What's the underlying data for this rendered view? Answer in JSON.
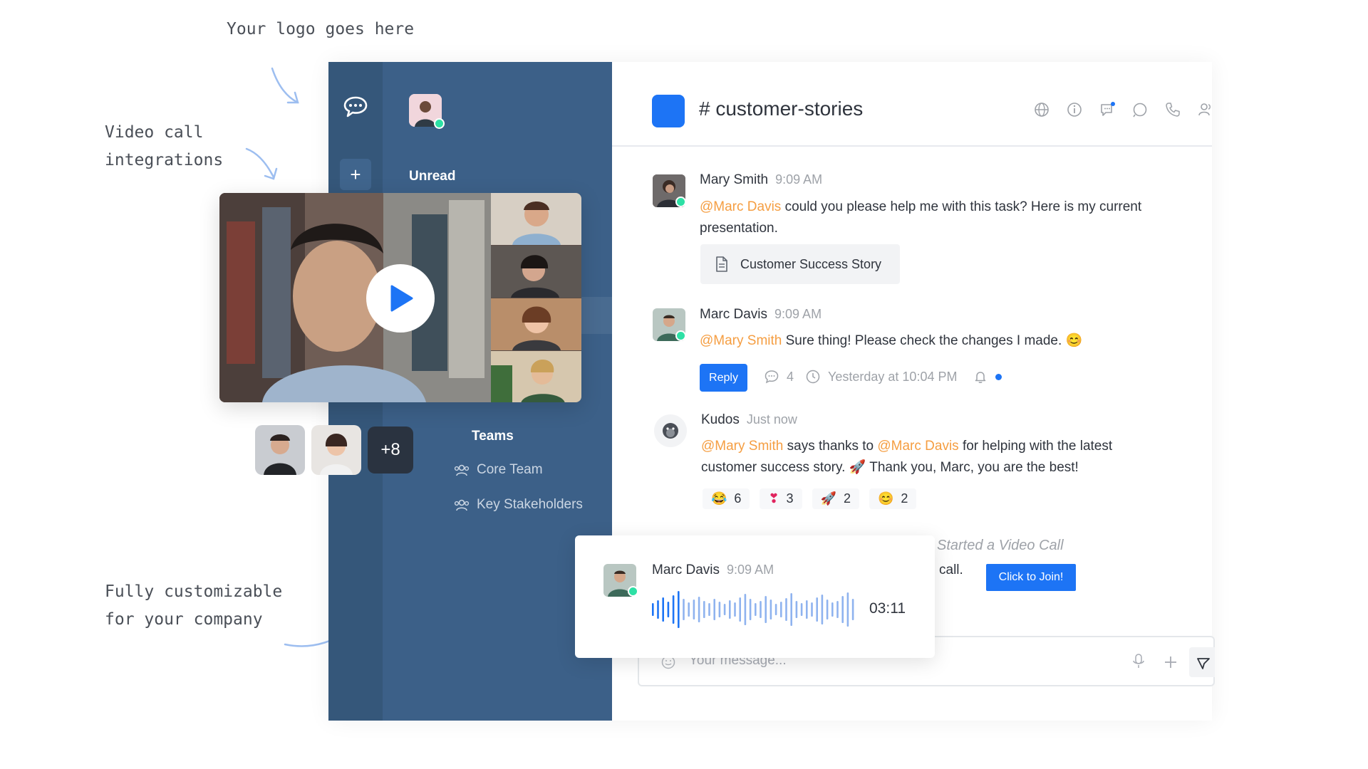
{
  "annotations": {
    "logo": "Your logo goes here",
    "video_line1": "Video call",
    "video_line2": "integrations",
    "custom_line1": "Fully customizable",
    "custom_line2": "for your company"
  },
  "rail": {
    "logo_icon": "chat-bubble-icon",
    "plus": "+"
  },
  "sidebar": {
    "section_unread": "Unread",
    "section_teams": "Teams",
    "teams": [
      {
        "label": "Core Team",
        "icon": "team-icon"
      },
      {
        "label": "Key Stakeholders",
        "icon": "team-icon"
      }
    ]
  },
  "header": {
    "channel": "# customer-stories",
    "icons": [
      "globe-icon",
      "info-icon",
      "threads-icon",
      "discussion-icon",
      "phone-icon",
      "members-icon"
    ]
  },
  "messages": [
    {
      "author": "Mary Smith",
      "time": "9:09 AM",
      "mention": "@Marc Davis",
      "text": " could you please help me with this task? Here is my current presentation.",
      "attachment": "Customer Success Story"
    },
    {
      "author": "Marc Davis",
      "time": "9:09 AM",
      "mention": "@Mary Smith",
      "text": " Sure thing! Please check the changes I made. 😊",
      "reply_label": "Reply",
      "reply_count": "4",
      "last_reply": "Yesterday at 10:04 PM"
    },
    {
      "author": "Kudos",
      "time": "Just now",
      "mention1": "@Mary Smith",
      "text1": " says thanks to ",
      "mention2": "@Marc Davis",
      "text2": " for helping with the latest customer success story. 🚀 Thank you, Marc, you are the best!",
      "reactions": [
        {
          "emoji": "😂",
          "count": "6"
        },
        {
          "emoji": "❣",
          "count": "3"
        },
        {
          "emoji": "🚀",
          "count": "2"
        },
        {
          "emoji": "😊",
          "count": "2"
        }
      ]
    }
  ],
  "video_call": {
    "system": "Started a Video Call",
    "call_text": "call.",
    "join_label": "Click to Join!",
    "more_participants": "+8"
  },
  "audio_message": {
    "author": "Marc Davis",
    "time": "9:09 AM",
    "duration": "03:11"
  },
  "composer": {
    "placeholder": "Your message..."
  },
  "colors": {
    "accent": "#1d74f5",
    "sidebar": "#3c6088",
    "mention": "#f59e42",
    "online": "#2de0a5"
  }
}
